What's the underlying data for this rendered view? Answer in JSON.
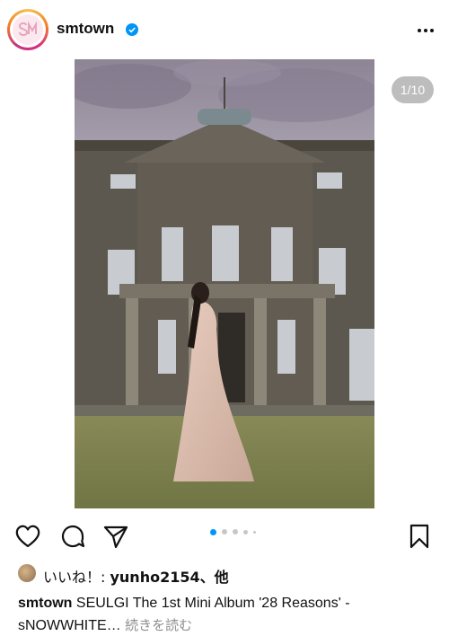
{
  "header": {
    "username": "smtown",
    "verified_icon": "verified-badge-icon",
    "more_icon": "more-horizontal-icon",
    "avatar_logo_text": "SM"
  },
  "media": {
    "counter": "1/10",
    "image_description_icon": "photo-woman-in-gown-before-manor"
  },
  "carousel": {
    "total_dots": 5,
    "active_index": 0,
    "active_color": "#0095f6",
    "inactive_color": "#c7c7c7"
  },
  "actions": {
    "like_icon": "heart-icon",
    "comment_icon": "comment-icon",
    "share_icon": "send-icon",
    "save_icon": "bookmark-icon"
  },
  "likes": {
    "prefix": "いいね！: ",
    "user": "yunho2154",
    "suffix": "、他"
  },
  "caption": {
    "user": "smtown",
    "text": "SEULGI The 1st Mini Album '28 Reasons' - sNOWWHITE…",
    "more_label": "続きを読む"
  }
}
